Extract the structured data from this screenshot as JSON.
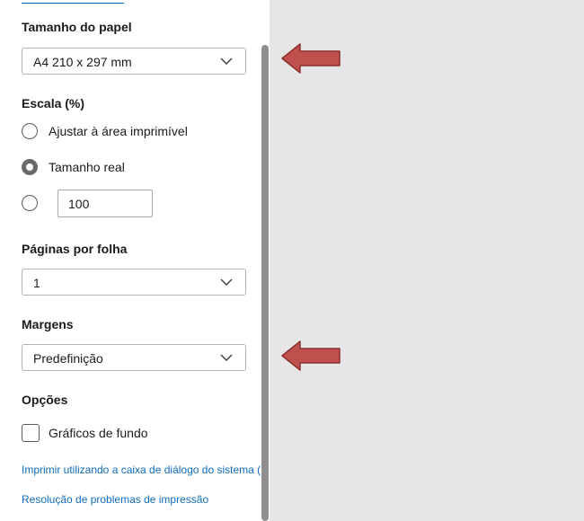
{
  "paper_size": {
    "heading": "Tamanho do papel",
    "selected": "A4 210 x 297 mm"
  },
  "scale": {
    "heading": "Escala (%)",
    "options": [
      {
        "label": "Ajustar à área imprimível",
        "checked": false
      },
      {
        "label": "Tamanho real",
        "checked": true
      },
      {
        "label": "",
        "checked": false
      }
    ],
    "custom_value": "100"
  },
  "pages_per_sheet": {
    "heading": "Páginas por folha",
    "selected": "1"
  },
  "margins": {
    "heading": "Margens",
    "selected": "Predefinição"
  },
  "options": {
    "heading": "Opções",
    "background_graphics_label": "Gráficos de fundo",
    "background_graphics_checked": false
  },
  "links": {
    "system_dialog": "Imprimir utilizando a caixa de diálogo do sistema (",
    "troubleshoot": "Resolução de problemas de impressão"
  },
  "colors": {
    "accent_link": "#0f6cbd",
    "preview_bg": "#e6e6e6",
    "annotation_arrow": "#c0504d"
  }
}
